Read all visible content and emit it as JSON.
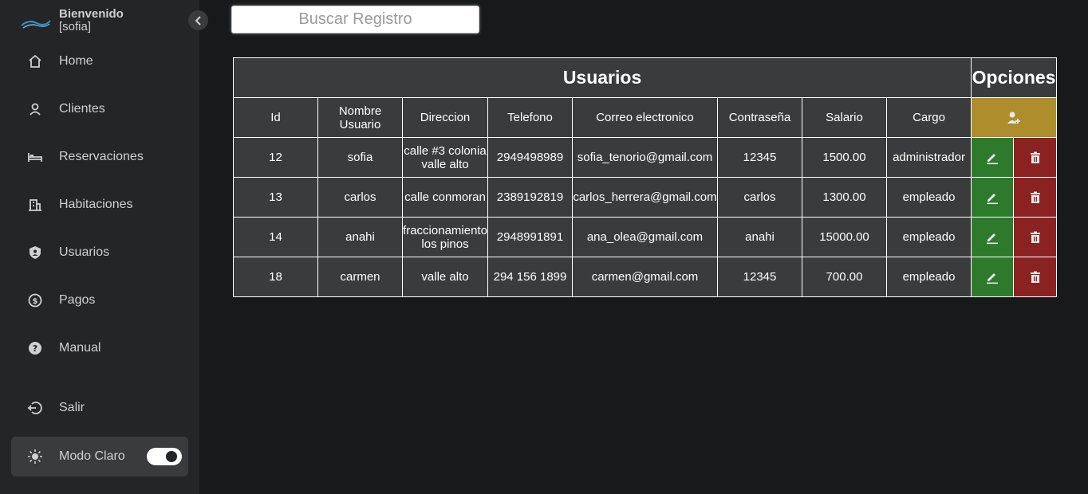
{
  "sidebar": {
    "welcome": "Bienvenido",
    "user": "[sofia]",
    "items": [
      {
        "label": "Home",
        "icon": "home-icon"
      },
      {
        "label": "Clientes",
        "icon": "user-icon"
      },
      {
        "label": "Reservaciones",
        "icon": "bed-icon"
      },
      {
        "label": "Habitaciones",
        "icon": "building-icon"
      },
      {
        "label": "Usuarios",
        "icon": "shield-user-icon"
      },
      {
        "label": "Pagos",
        "icon": "dollar-circle-icon"
      },
      {
        "label": "Manual",
        "icon": "help-circle-icon"
      }
    ],
    "logout": "Salir",
    "mode_label": "Modo Claro",
    "mode_toggle_on": true
  },
  "search": {
    "placeholder": "Buscar Registro"
  },
  "table": {
    "title": "Usuarios",
    "options_title": "Opciones",
    "columns": [
      "Id",
      "Nombre Usuario",
      "Direccion",
      "Telefono",
      "Correo electronico",
      "Contraseña",
      "Salario",
      "Cargo"
    ],
    "rows": [
      [
        "12",
        "sofia",
        "calle #3 colonia valle alto",
        "2949498989",
        "sofia_tenorio@gmail.com",
        "12345",
        "1500.00",
        "administrador"
      ],
      [
        "13",
        "carlos",
        "calle conmoran",
        "2389192819",
        "carlos_herrera@gmail.com",
        "carlos",
        "1300.00",
        "empleado"
      ],
      [
        "14",
        "anahi",
        "fraccionamiento los pinos",
        "2948991891",
        "ana_olea@gmail.com",
        "anahi",
        "15000.00",
        "empleado"
      ],
      [
        "18",
        "carmen",
        "valle alto",
        "294 156 1899",
        "carmen@gmail.com",
        "12345",
        "700.00",
        "empleado"
      ]
    ]
  },
  "colors": {
    "background": "#18191a",
    "sidebar": "#242526",
    "add": "#ad8d2c",
    "edit": "#2d7a2d",
    "delete": "#8a2222"
  }
}
